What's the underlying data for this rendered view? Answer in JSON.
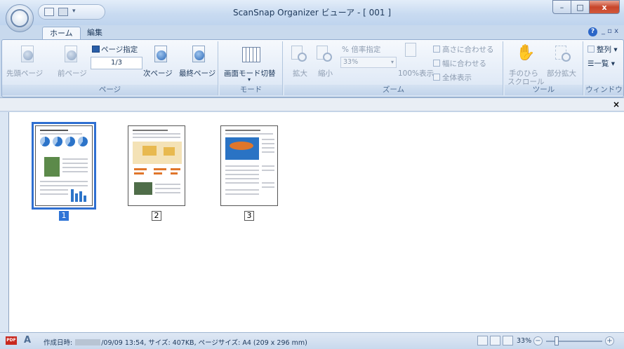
{
  "window": {
    "title": "ScanSnap Organizer ビューア - [ 001 ]",
    "minimize": "–",
    "maximize": "□",
    "close": "x"
  },
  "tabs": [
    {
      "label": "ホーム",
      "active": true
    },
    {
      "label": "編集",
      "active": false
    }
  ],
  "ribbon_right_controls": "_ ▫ x",
  "ribbon": {
    "page_group": {
      "label": "ページ",
      "first_page": "先頭ページ",
      "prev_page": "前ページ",
      "page_specify": "ページ指定",
      "page_value": "1/3",
      "next_page": "次ページ",
      "last_page": "最終ページ"
    },
    "mode_group": {
      "label": "モード",
      "screen_mode_toggle": "画面モード切替"
    },
    "zoom_group": {
      "label": "ズーム",
      "zoom_in": "拡大",
      "zoom_out": "縮小",
      "zoom_percent_label": "倍率指定",
      "zoom_value": "33%",
      "zoom_100": "100%表示",
      "fit_height": "高さに合わせる",
      "fit_width": "幅に合わせる",
      "show_all": "全体表示"
    },
    "tool_group": {
      "label": "ツール",
      "hand_scroll_line1": "手のひら",
      "hand_scroll_line2": "スクロール",
      "partial_zoom": "部分拡大"
    },
    "window_group": {
      "label": "ウィンドウ",
      "arrange": "整列",
      "list": "一覧"
    }
  },
  "infobar": {
    "close": "×"
  },
  "thumbnails": [
    {
      "number": "1",
      "selected": true
    },
    {
      "number": "2",
      "selected": false
    },
    {
      "number": "3",
      "selected": false
    }
  ],
  "status_bar": {
    "created_label": "作成日時:",
    "created_value": "/09/09 13:54, サイズ: 407KB, ページサイズ: A4 (209 x 296 mm)",
    "pdf_badge": "PDF",
    "zoom": "33%",
    "zoom_minus": "−",
    "zoom_plus": "+"
  },
  "colors": {
    "selection": "#2f74d6",
    "ribbon_bg": "#e2ebf7",
    "close_button": "#c7452b"
  }
}
